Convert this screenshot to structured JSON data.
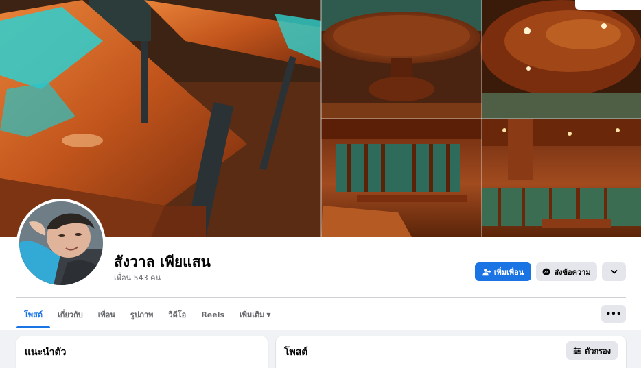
{
  "profile": {
    "name": "สังวาล เพียแสน",
    "friends_count": "เพื่อน 543 คน"
  },
  "actions": {
    "add_friend": "เพิ่มเพื่อน",
    "message": "ส่งข้อความ"
  },
  "tabs": [
    {
      "label": "โพสต์",
      "active": true
    },
    {
      "label": "เกี่ยวกับ",
      "active": false
    },
    {
      "label": "เพื่อน",
      "active": false
    },
    {
      "label": "รูปภาพ",
      "active": false
    },
    {
      "label": "วิดีโอ",
      "active": false
    },
    {
      "label": "Reels",
      "active": false
    },
    {
      "label": "เพิ่มเติม",
      "active": false
    }
  ],
  "intro_card": {
    "title": "แนะนำตัว"
  },
  "posts_card": {
    "title": "โพสต์",
    "filter_label": "ตัวกรอง"
  },
  "colors": {
    "accent": "#1b74e4",
    "muted_text": "#65676b",
    "button_bg": "#e4e6eb"
  }
}
